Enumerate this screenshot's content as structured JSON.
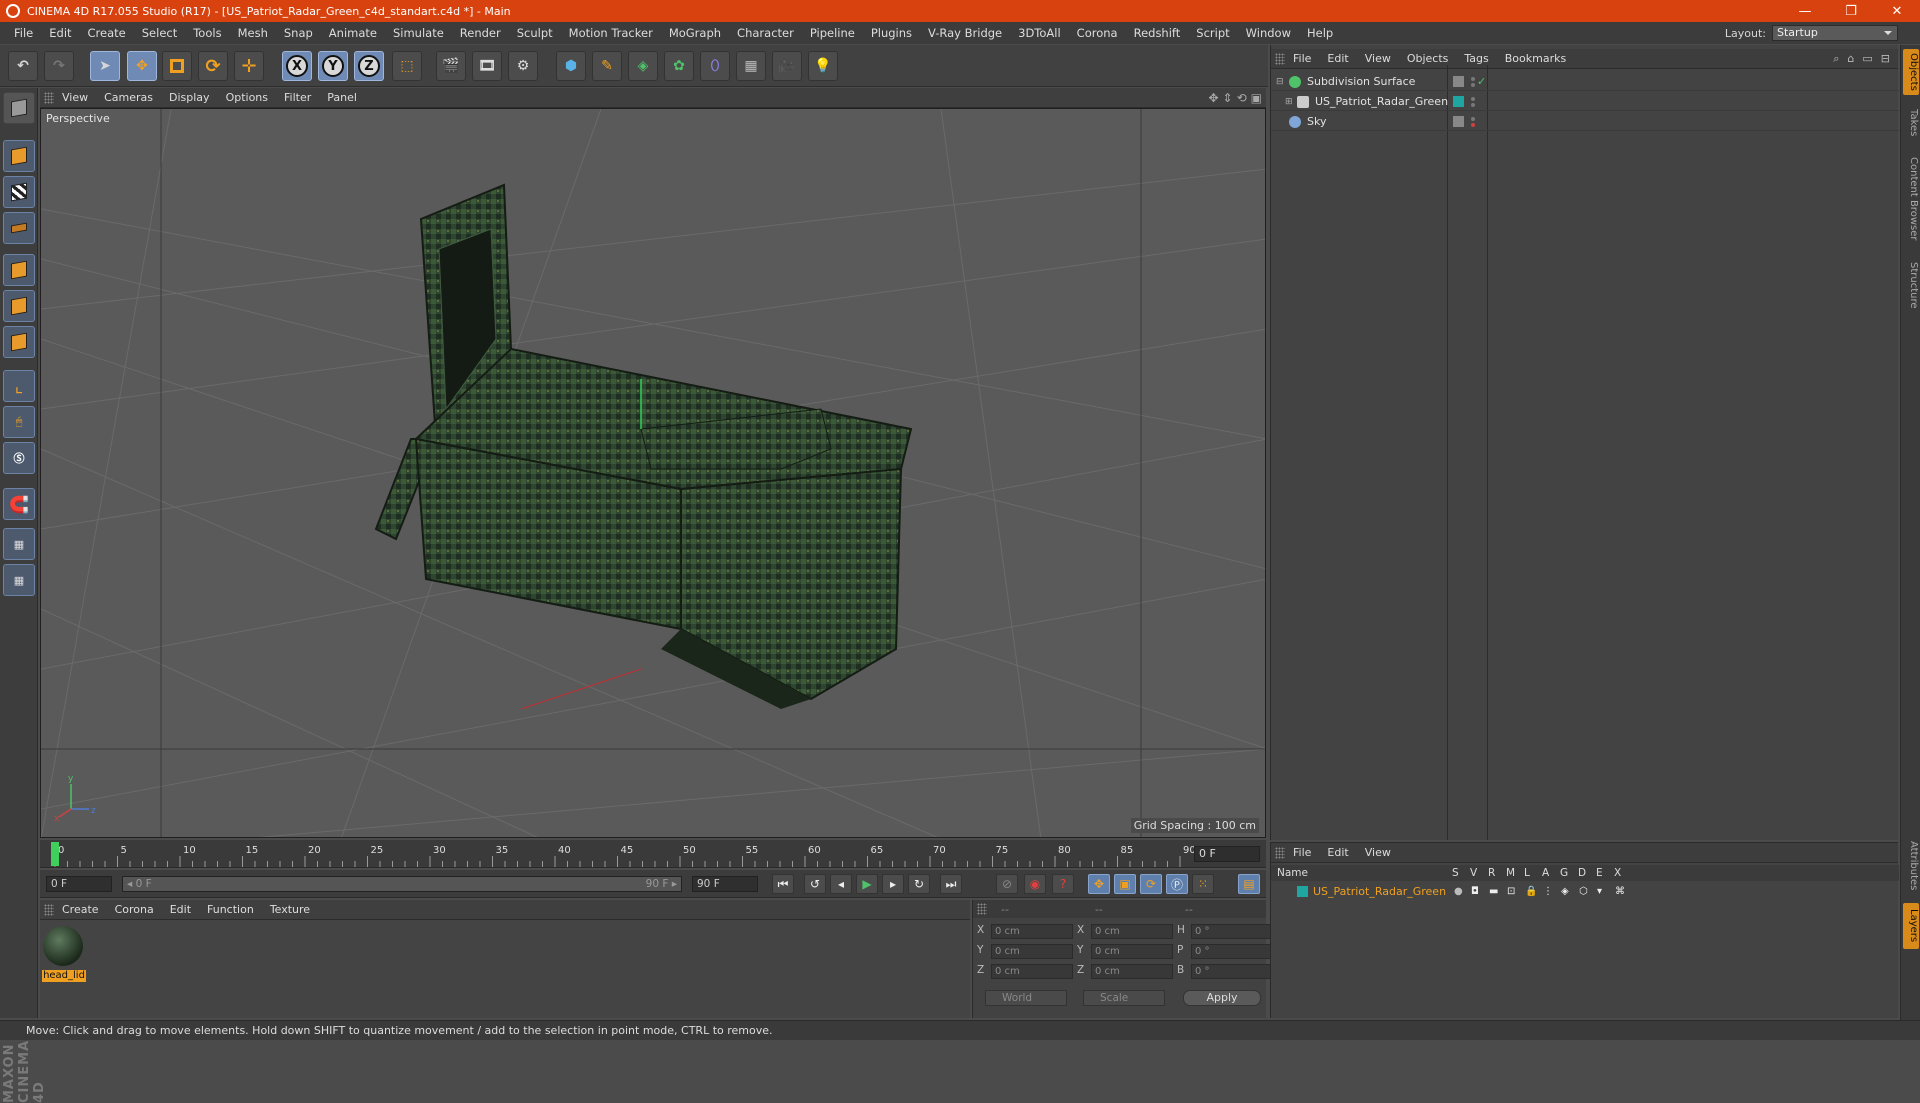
{
  "window": {
    "title": "CINEMA 4D R17.055 Studio (R17) - [US_Patriot_Radar_Green_c4d_standart.c4d *] - Main",
    "minimize": "—",
    "maximize": "❐",
    "close": "✕"
  },
  "menubar": {
    "items": [
      "File",
      "Edit",
      "Create",
      "Select",
      "Tools",
      "Mesh",
      "Snap",
      "Animate",
      "Simulate",
      "Render",
      "Sculpt",
      "Motion Tracker",
      "MoGraph",
      "Character",
      "Pipeline",
      "Plugins",
      "V-Ray Bridge",
      "3DToAll",
      "Corona",
      "Redshift",
      "Script",
      "Window",
      "Help"
    ],
    "layout_label": "Layout:",
    "layout_value": "Startup"
  },
  "toolbar": {
    "undo_icon": "undo-icon",
    "redo_icon": "redo-icon",
    "axis_x": "X",
    "axis_y": "Y",
    "axis_z": "Z"
  },
  "viewport": {
    "menu": [
      "View",
      "Cameras",
      "Display",
      "Options",
      "Filter",
      "Panel"
    ],
    "camera_label": "Perspective",
    "grid_spacing": "Grid Spacing : 100 cm",
    "axis_y": "y",
    "axis_x": "x",
    "axis_z": "z"
  },
  "timeline": {
    "ticks": [
      "0",
      "5",
      "10",
      "15",
      "20",
      "25",
      "30",
      "35",
      "40",
      "45",
      "50",
      "55",
      "60",
      "65",
      "70",
      "75",
      "80",
      "85",
      "90"
    ],
    "current_frame": "0 F"
  },
  "playbar": {
    "start_field": "0 F",
    "range_start": "◂ 0 F",
    "range_end": "90 F ▸",
    "end_field": "90 F"
  },
  "materials": {
    "menu": [
      "Create",
      "Corona",
      "Edit",
      "Function",
      "Texture"
    ],
    "items": [
      {
        "name": "head_lid"
      }
    ]
  },
  "coordinates": {
    "headers": [
      "--",
      "--",
      "--"
    ],
    "rows": [
      {
        "l1": "X",
        "v1": "0 cm",
        "l2": "X",
        "v2": "0 cm",
        "l3": "H",
        "v3": "0 °"
      },
      {
        "l1": "Y",
        "v1": "0 cm",
        "l2": "Y",
        "v2": "0 cm",
        "l3": "P",
        "v3": "0 °"
      },
      {
        "l1": "Z",
        "v1": "0 cm",
        "l2": "Z",
        "v2": "0 cm",
        "l3": "B",
        "v3": "0 °"
      }
    ],
    "mode_world": "World",
    "mode_scale": "Scale",
    "apply": "Apply"
  },
  "objects": {
    "menu": [
      "File",
      "Edit",
      "View",
      "Objects",
      "Tags",
      "Bookmarks"
    ],
    "tree": [
      {
        "name": "Subdivision Surface",
        "icon_color": "#4fc26a"
      },
      {
        "name": "US_Patriot_Radar_Green",
        "icon_color": "#cccccc"
      },
      {
        "name": "Sky",
        "icon_color": "#7fa6d6"
      }
    ],
    "check": "✓"
  },
  "layers": {
    "menu": [
      "File",
      "Edit",
      "View"
    ],
    "columns": [
      "Name",
      "S",
      "V",
      "R",
      "M",
      "L",
      "A",
      "G",
      "D",
      "E",
      "X"
    ],
    "rows": [
      {
        "name": "US_Patriot_Radar_Green",
        "color": "#1fa6a0"
      }
    ]
  },
  "right_tabs": [
    "Objects",
    "Takes",
    "Content Browser",
    "Structure",
    "Attributes",
    "Layers"
  ],
  "maxon_brand": "MAXON CINEMA 4D",
  "statusbar": {
    "text": "Move: Click and drag to move elements. Hold down SHIFT to quantize movement / add to the selection in point mode, CTRL to remove."
  },
  "colors": {
    "titlebar": "#d8420f",
    "accent_orange": "#f0a020",
    "active_tool": "#6f8bb5",
    "model_green": "#2f4a2f"
  }
}
